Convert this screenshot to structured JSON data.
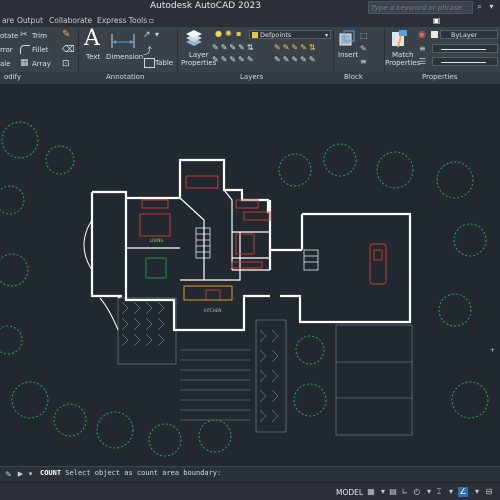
{
  "app_title": "Autodesk AutoCAD 2023",
  "search": {
    "placeholder": "Type a keyword or phrase"
  },
  "tabs": [
    "are",
    "Output",
    "Collaborate",
    "Express Tools"
  ],
  "modify": {
    "items": [
      "otate",
      "Trim",
      "rror",
      "Fillet",
      "ale",
      "Array"
    ],
    "panel_title": "odify"
  },
  "annotation": {
    "text_label": "Text",
    "dimension_label": "Dimension",
    "table_label": "Table",
    "panel_title": "Annotation"
  },
  "layers": {
    "layer_properties_label": "Layer\nProperties",
    "current_layer": "Defpoints",
    "panel_title": "Layers"
  },
  "block": {
    "insert_label": "Insert",
    "panel_title": "Block"
  },
  "properties": {
    "match_label": "Match\nProperties",
    "color_value": "ByLayer",
    "panel_title": "Properties"
  },
  "drawing": {
    "room_labels": [
      "LIVING",
      "KITCHEN"
    ]
  },
  "command": {
    "name": "COUNT",
    "prompt": "Select object as count area boundary:"
  },
  "status": {
    "model_label": "MODEL"
  },
  "colors": {
    "accent_blue": "#2f6fb6",
    "wall_white": "#ffffff",
    "furniture_red": "#d2402d",
    "tree_green": "#2aa84a"
  }
}
